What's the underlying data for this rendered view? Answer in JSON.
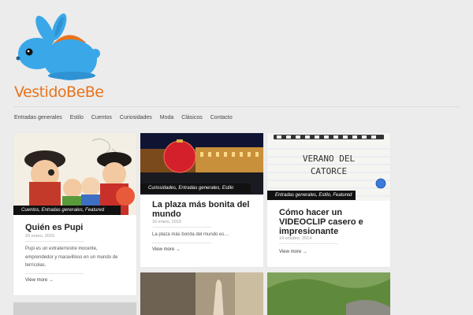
{
  "brand": {
    "name_part1": "Vestido",
    "name_part2": "BeBe",
    "accent": "#e8731c",
    "mascot_color": "#3aa7e8"
  },
  "nav": {
    "items": [
      "Entradas generales",
      "Estilo",
      "Cuentos",
      "Curiosidades",
      "Moda",
      "Clásicos",
      "Contacto"
    ]
  },
  "posts": [
    {
      "categories": "Cuentos, Entradas generales, Featured",
      "title": "Quién es Pupi",
      "date": "20 enero, 2015",
      "excerpt": "Pupi es un extraterrestre inocente, emprendedor y maravilloso en un mundo de terrícolas.",
      "more": "View more →"
    },
    {
      "categories": "Curiosidades, Entradas generales, Estilo",
      "title": "La plaza más bonita del mundo",
      "date": "16 enero, 2015",
      "excerpt": "La plaza más bonita del mundo es…",
      "more": "View more →"
    },
    {
      "categories": "Entradas generales, Estilo, Featured",
      "title": "Cómo hacer un VIDEOCLIP casero e impresionante",
      "date": "14 octubre, 2014",
      "more": "View more →",
      "image_text_line1": "VERANO DEL",
      "image_text_line2": "CATORCE"
    }
  ]
}
